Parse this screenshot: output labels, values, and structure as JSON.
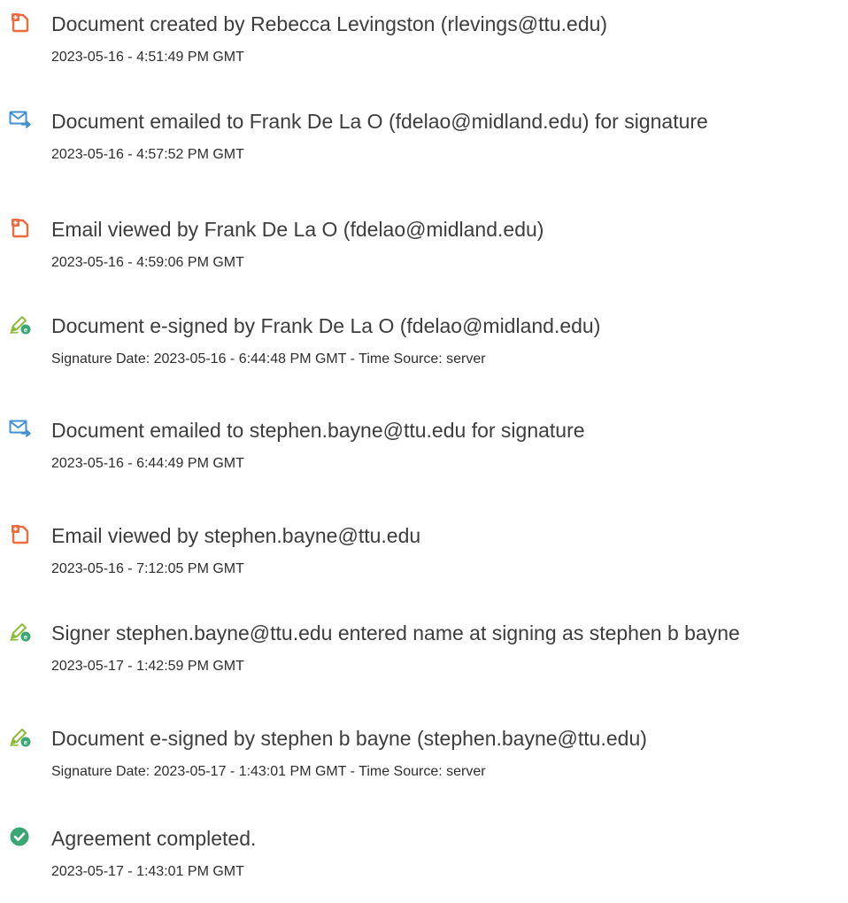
{
  "events": [
    {
      "icon": "document-created-icon",
      "title": "Document created by Rebecca Levingston (rlevings@ttu.edu)",
      "subtitle": "2023-05-16 - 4:51:49 PM GMT"
    },
    {
      "icon": "email-sent-icon",
      "title": "Document emailed to Frank De La O (fdelao@midland.edu) for signature",
      "subtitle": "2023-05-16 - 4:57:52 PM GMT"
    },
    {
      "icon": "document-viewed-icon",
      "title": "Email viewed by Frank De La O (fdelao@midland.edu)",
      "subtitle": "2023-05-16 - 4:59:06 PM GMT"
    },
    {
      "icon": "esign-pen-icon",
      "title": "Document e-signed by Frank De La O (fdelao@midland.edu)",
      "subtitle": "Signature Date: 2023-05-16 - 6:44:48 PM GMT - Time Source: server"
    },
    {
      "icon": "email-sent-icon",
      "title": "Document emailed to stephen.bayne@ttu.edu for signature",
      "subtitle": "2023-05-16 - 6:44:49 PM GMT"
    },
    {
      "icon": "document-viewed-icon",
      "title": "Email viewed by stephen.bayne@ttu.edu",
      "subtitle": "2023-05-16 - 7:12:05 PM GMT"
    },
    {
      "icon": "esign-pen-icon",
      "title": "Signer stephen.bayne@ttu.edu entered name at signing as stephen b bayne",
      "subtitle": "2023-05-17 - 1:42:59 PM GMT"
    },
    {
      "icon": "esign-pen-icon",
      "title": "Document e-signed by stephen b bayne (stephen.bayne@ttu.edu)",
      "subtitle": "Signature Date: 2023-05-17 - 1:43:01 PM GMT - Time Source: server"
    },
    {
      "icon": "completed-check-icon",
      "title": "Agreement completed.",
      "subtitle": "2023-05-17 - 1:43:01 PM GMT"
    }
  ],
  "colors": {
    "document_icon": "#f26b3a",
    "email_icon": "#3f8fd2",
    "pen_icon": "#8dbb3a",
    "check_icon": "#3aa874",
    "title_text": "#3d3d3d",
    "subtitle_text": "#2e2e2e"
  }
}
